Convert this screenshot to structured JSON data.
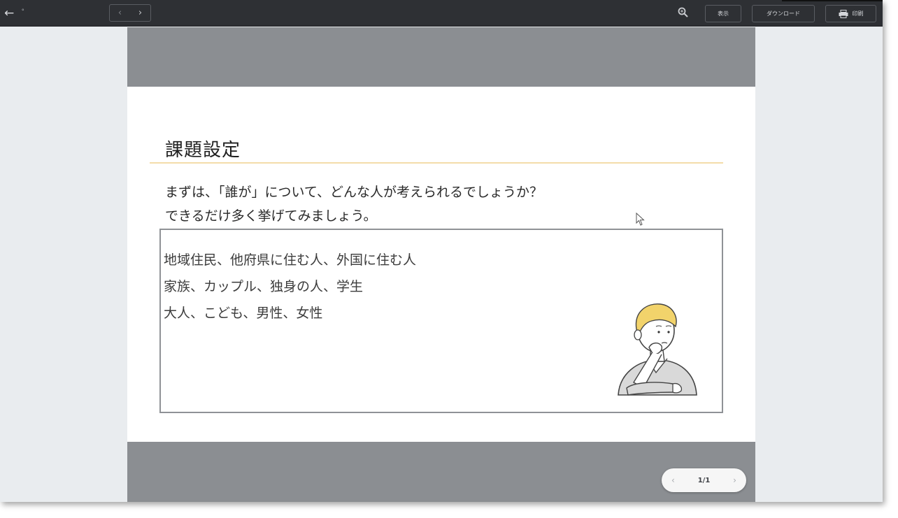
{
  "toolbar": {
    "back_icon": "←",
    "back_dot": "˚",
    "prev_icon": "‹",
    "next_icon": "›",
    "show_label": "表示",
    "download_label": "ダウンロード",
    "print_label": "印刷"
  },
  "slide": {
    "title": "課題設定",
    "question_line1": "まずは、「誰が」について、どんな人が考えられるでしょうか？",
    "question_line2": "できるだけ多く挙げてみましょう。",
    "answers": [
      "地域住民、他府県に住む人、外国に住む人",
      "家族、カップル、独身の人、学生",
      "大人、こども、男性、女性"
    ]
  },
  "pager": {
    "prev_icon": "‹",
    "page": "1/1",
    "next_icon": "›"
  },
  "colors": {
    "toolbar_bg": "#2e3034",
    "viewer_gray": "#8b8e92",
    "title_rule": "#f3dcaa",
    "hair_yellow": "#f2d36b"
  }
}
